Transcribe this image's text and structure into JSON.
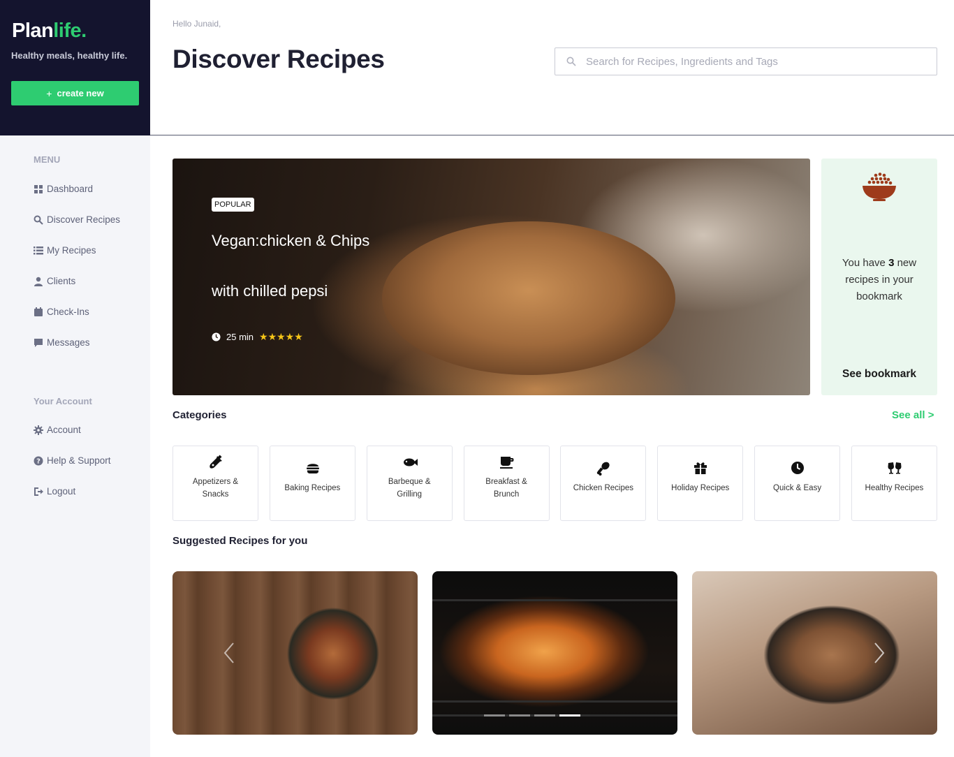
{
  "brand": {
    "name_main": "Plan",
    "name_accent": "life.",
    "tagline": "Healthy meals, healthy life.",
    "create_label": "create new",
    "create_icon": "plus-icon"
  },
  "colors": {
    "sidebar_top": "#14142e",
    "accent": "#2ecc71",
    "sidebar_bg": "#f4f5f9",
    "bookmark_bg": "#eaf7ee",
    "star": "#f5c518"
  },
  "menu": {
    "heading": "MENU",
    "items": [
      {
        "label": "Dashboard",
        "icon": "grid-icon"
      },
      {
        "label": "Discover Recipes",
        "icon": "search-icon"
      },
      {
        "label": "My Recipes",
        "icon": "list-icon"
      },
      {
        "label": "Clients",
        "icon": "user-icon"
      },
      {
        "label": "Check-Ins",
        "icon": "calendar-icon"
      },
      {
        "label": "Messages",
        "icon": "chat-icon"
      }
    ]
  },
  "account": {
    "heading": "Your Account",
    "items": [
      {
        "label": "Account",
        "icon": "gear-icon"
      },
      {
        "label": "Help & Support",
        "icon": "question-icon"
      },
      {
        "label": "Logout",
        "icon": "logout-icon"
      }
    ]
  },
  "header": {
    "greeting": "Hello Junaid,",
    "title": "Discover Recipes",
    "search_placeholder": "Search for Recipes, Ingredients and Tags",
    "search_value": ""
  },
  "hero": {
    "badge": "POPULAR",
    "line1": "Vegan:chicken & Chips",
    "line2": "with chilled pepsi",
    "time": "25 min",
    "rating": 5,
    "stars": "★★★★★"
  },
  "bookmark": {
    "text_before": "You have",
    "count": "3",
    "text_after": "new recipes in your bookmark",
    "link": "See bookmark"
  },
  "categories": {
    "title": "Categories",
    "see_all": "See all  >",
    "items": [
      {
        "line1": "Appetizers &",
        "line2": "Snacks",
        "icon": "bottle-icon"
      },
      {
        "line1": "Baking Recipes",
        "line2": "",
        "icon": "burger-icon"
      },
      {
        "line1": "Barbeque &",
        "line2": "Grilling",
        "icon": "fish-icon"
      },
      {
        "line1": "Breakfast &",
        "line2": "Brunch",
        "icon": "coffee-cup-icon"
      },
      {
        "line1": "Chicken Recipes",
        "line2": "",
        "icon": "drumstick-icon"
      },
      {
        "line1": "Holiday Recipes",
        "line2": "",
        "icon": "gift-icon"
      },
      {
        "line1": "Quick & Easy",
        "line2": "",
        "icon": "clock-icon"
      },
      {
        "line1": "Healthy Recipes",
        "line2": "",
        "icon": "glasses-toast-icon"
      }
    ]
  },
  "suggested": {
    "title": "Suggested Recipes for you",
    "dots": 4,
    "active_dot": 4
  }
}
